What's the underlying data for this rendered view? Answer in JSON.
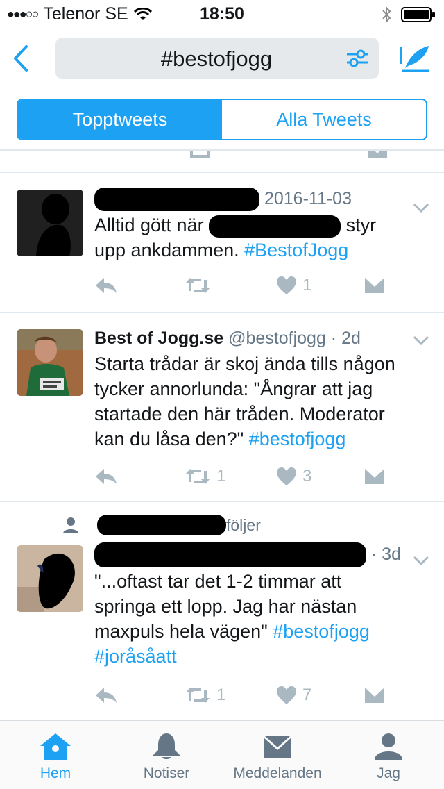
{
  "status_bar": {
    "signal_dots": "●●●○○",
    "carrier": "Telenor SE",
    "time": "18:50"
  },
  "navbar": {
    "search_query": "#bestofjogg"
  },
  "tabs": [
    {
      "label": "Topptweets",
      "active": true
    },
    {
      "label": "Alla Tweets",
      "active": false
    }
  ],
  "tweets": [
    {
      "date": "2016-11-03",
      "text_part1": "Alltid gött när ",
      "text_part2": " styr upp ankdammen. ",
      "hashtag": "#BestofJogg",
      "like_count": "1"
    },
    {
      "name": "Best of Jogg.se",
      "handle": "@bestofjogg",
      "time": " · 2d",
      "text": "Starta trådar är skoj ända tills någon tycker annorlunda: \"Ångrar att jag startade den här tråden. Moderator kan du låsa den?\" ",
      "hashtag": "#bestofjogg",
      "retweet_count": "1",
      "like_count": "3"
    },
    {
      "social_context": "följer",
      "time": "· 3d",
      "text": "\"...oftast tar det 1-2 timmar att springa ett lopp. Jag har nästan maxpuls hela vägen\" ",
      "hashtag1": "#bestofjogg",
      "hashtag2": "#joråsåatt",
      "retweet_count": "1",
      "like_count": "7"
    }
  ],
  "tabbar": [
    {
      "label": "Hem",
      "icon": "home-icon",
      "active": true
    },
    {
      "label": "Notiser",
      "icon": "bell-icon",
      "active": false
    },
    {
      "label": "Meddelanden",
      "icon": "envelope-icon",
      "active": false
    },
    {
      "label": "Jag",
      "icon": "person-icon",
      "active": false
    }
  ],
  "colors": {
    "accent": "#1da1f2",
    "meta_text": "#657786",
    "action_icon": "#aab8c2"
  }
}
